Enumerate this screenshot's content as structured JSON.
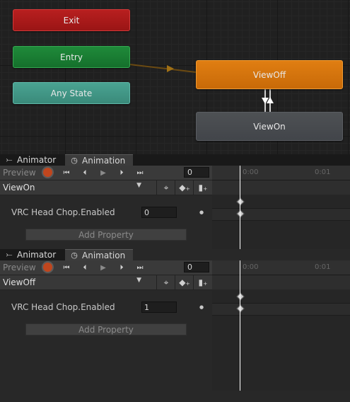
{
  "animator_graph": {
    "nodes": {
      "exit": "Exit",
      "entry": "Entry",
      "any_state": "Any State",
      "view_off": "ViewOff",
      "view_on": "ViewOn"
    }
  },
  "panels": [
    {
      "tabs": {
        "animator": "Animator",
        "animation": "Animation"
      },
      "toolbar": {
        "preview_label": "Preview",
        "frame_value": "0"
      },
      "clip_selector": {
        "selected": "ViewOn"
      },
      "property": {
        "name": "VRC Head Chop.Enabled",
        "value": "0"
      },
      "add_property_label": "Add Property",
      "ruler": {
        "tick_0": "0:00",
        "tick_1": "0:01"
      }
    },
    {
      "tabs": {
        "animator": "Animator",
        "animation": "Animation"
      },
      "toolbar": {
        "preview_label": "Preview",
        "frame_value": "0"
      },
      "clip_selector": {
        "selected": "ViewOff"
      },
      "property": {
        "name": "VRC Head Chop.Enabled",
        "value": "1"
      },
      "add_property_label": "Add Property",
      "ruler": {
        "tick_0": "0:00",
        "tick_1": "0:01"
      }
    }
  ],
  "colors": {
    "exit": "#b81f1f",
    "entry": "#1f8a3a",
    "any_state": "#4aa392",
    "view_off": "#e07e12",
    "view_on": "#4e5154",
    "record": "#c0461e"
  }
}
